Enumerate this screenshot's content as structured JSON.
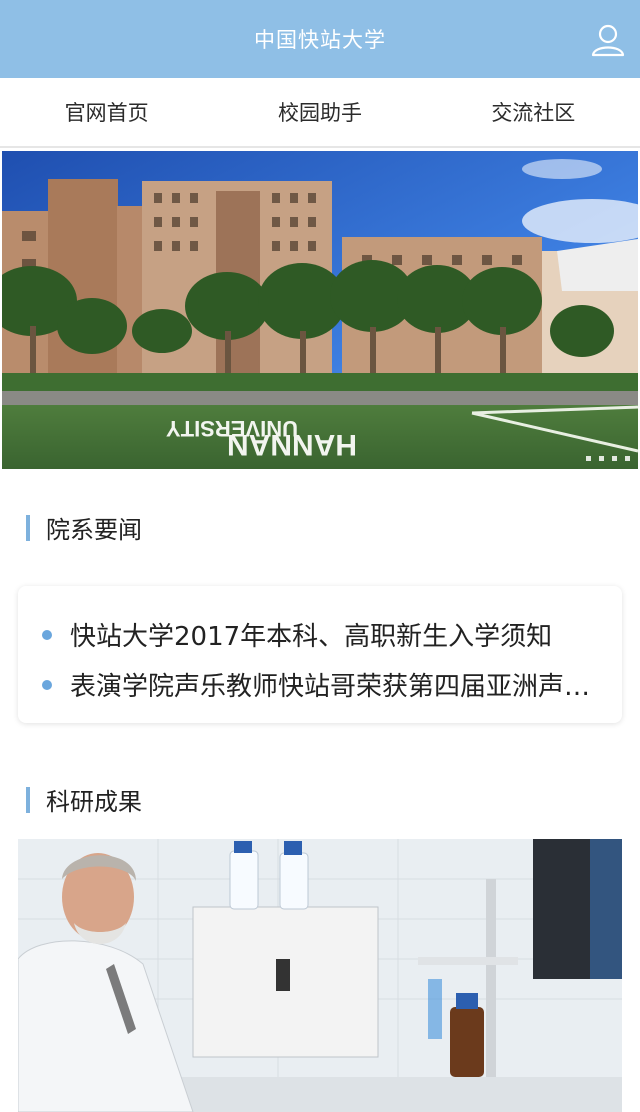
{
  "header": {
    "title": "中国快站大学",
    "user_icon": "user-icon"
  },
  "nav": {
    "items": [
      {
        "label": "官网首页"
      },
      {
        "label": "校园助手"
      },
      {
        "label": "交流社区"
      }
    ]
  },
  "banner": {
    "ground_text_line1": "HANNAN",
    "ground_text_line2": "UNIVERSITY",
    "slide_count": 4
  },
  "news_section": {
    "title": "院系要闻",
    "items": [
      {
        "text": "快站大学2017年本科、高职新生入学须知"
      },
      {
        "text": "表演学院声乐教师快站哥荣获第四届亚洲声乐比赛金奖"
      }
    ]
  },
  "research_section": {
    "title": "科研成果"
  },
  "colors": {
    "header_bg": "#8fbfe6",
    "accent": "#7eb1dd",
    "bullet": "#6aa6dd"
  }
}
